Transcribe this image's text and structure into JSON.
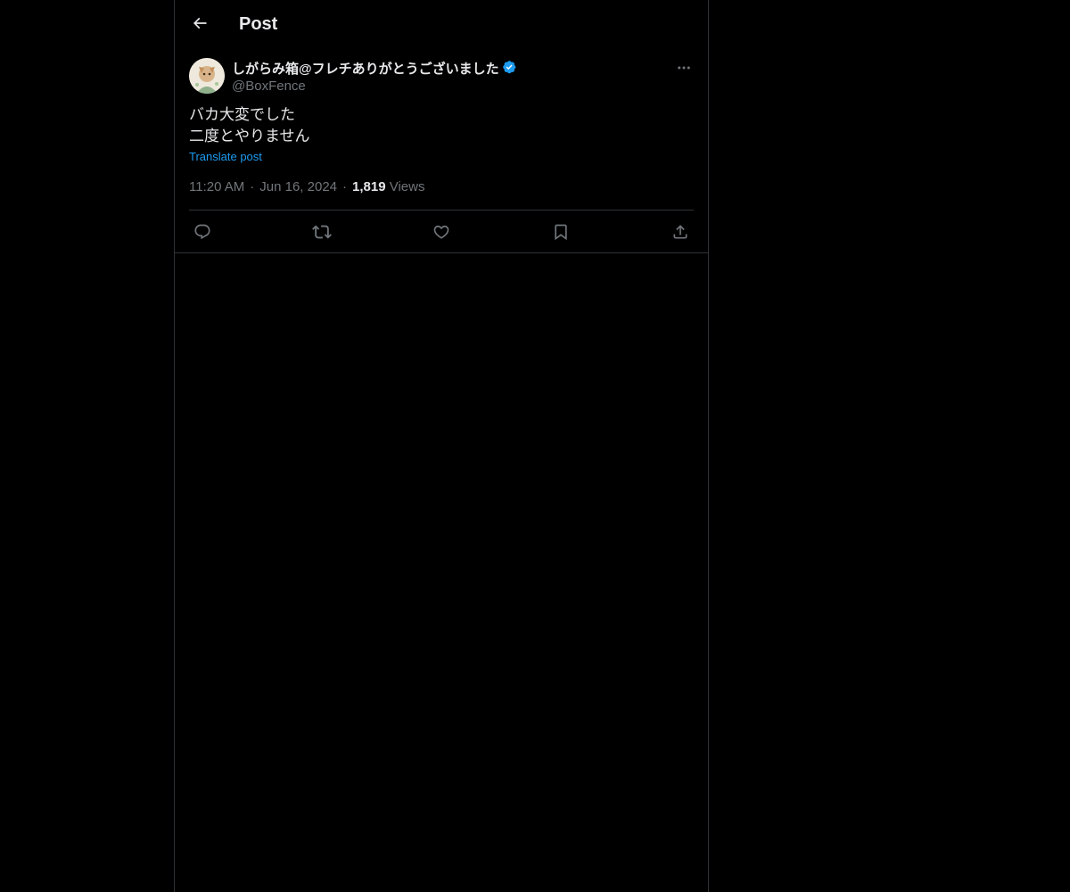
{
  "header": {
    "title": "Post"
  },
  "post": {
    "display_name": "しがらみ箱@フレチありがとうございました",
    "handle": "@BoxFence",
    "text_lines": [
      "バカ大変でした",
      "二度とやりません"
    ],
    "translate_label": "Translate post",
    "time": "11:20 AM",
    "date": "Jun 16, 2024",
    "separator": "·",
    "views_count": "1,819",
    "views_label": "Views"
  },
  "actions": [
    {
      "name": "reply-icon"
    },
    {
      "name": "repost-icon"
    },
    {
      "name": "like-icon"
    },
    {
      "name": "bookmark-icon"
    },
    {
      "name": "share-icon"
    }
  ],
  "colors": {
    "background": "#000000",
    "text": "#e7e9ea",
    "secondary": "#71767b",
    "accent": "#1d9bf0",
    "border": "#2f3336"
  }
}
